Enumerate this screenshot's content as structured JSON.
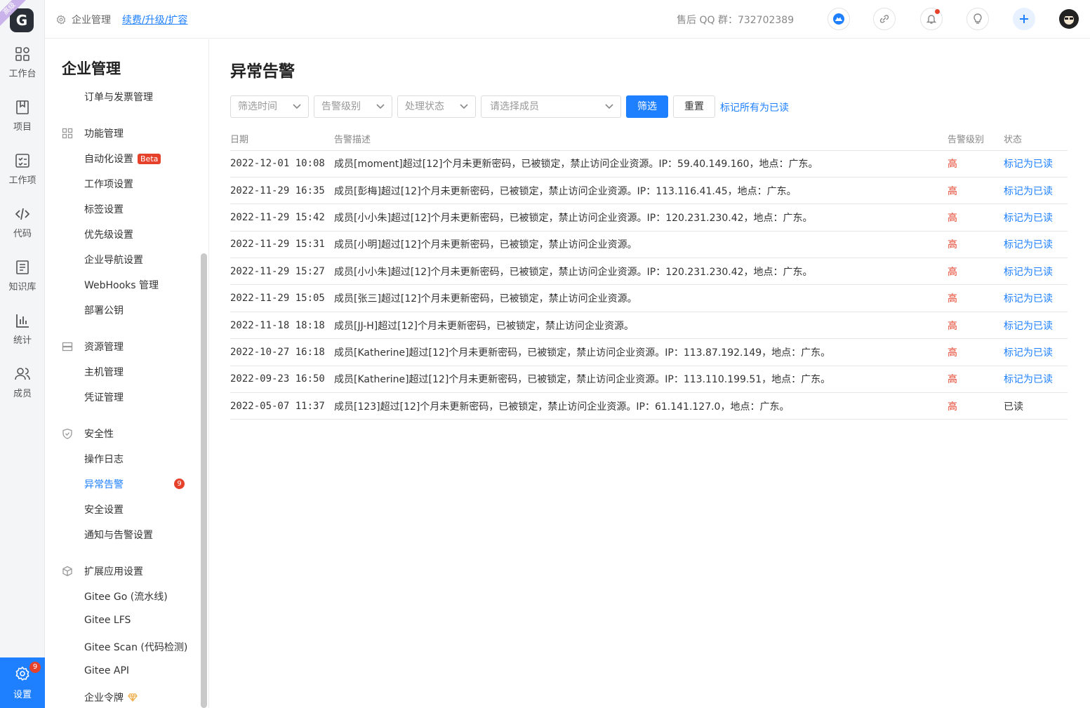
{
  "rail": {
    "logo": "G",
    "ribbon": "高级",
    "items": [
      {
        "label": "工作台"
      },
      {
        "label": "项目"
      },
      {
        "label": "工作项"
      },
      {
        "label": "代码"
      },
      {
        "label": "知识库"
      },
      {
        "label": "统计"
      },
      {
        "label": "成员"
      }
    ],
    "settings_label": "设置",
    "settings_badge": "9"
  },
  "topbar": {
    "crumb": "企业管理",
    "upgrade_link": "续费/升级/扩容",
    "qq": "售后 QQ 群：732702389"
  },
  "sidebar": {
    "title": "企业管理",
    "items": {
      "orders": "订单与发票管理",
      "func_group": "功能管理",
      "automation": "自动化设置",
      "beta": "Beta",
      "workitem": "工作项设置",
      "labels": "标签设置",
      "priority": "优先级设置",
      "navigation": "企业导航设置",
      "webhooks": "WebHooks 管理",
      "deploy_keys": "部署公钥",
      "resource_group": "资源管理",
      "hosts": "主机管理",
      "credentials": "凭证管理",
      "security_group": "安全性",
      "op_logs": "操作日志",
      "alerts": "异常告警",
      "alerts_badge": "9",
      "security_settings": "安全设置",
      "notify": "通知与告警设置",
      "ext_group": "扩展应用设置",
      "gitee_go": "Gitee Go (流水线)",
      "gitee_lfs": "Gitee LFS",
      "gitee_scan": "Gitee Scan (代码检测)",
      "gitee_api": "Gitee API",
      "token": "企业令牌"
    }
  },
  "main": {
    "title": "异常告警",
    "filters": {
      "time": "筛选时间",
      "level": "告警级别",
      "status": "处理状态",
      "member": "请选择成员"
    },
    "filter_btn": "筛选",
    "reset_btn": "重置",
    "mark_all": "标记所有为已读",
    "columns": {
      "date": "日期",
      "desc": "告警描述",
      "level": "告警级别",
      "status": "状态"
    },
    "rows": [
      {
        "date": "2022-12-01 10:08",
        "desc": "成员[moment]超过[12]个月未更新密码，已被锁定，禁止访问企业资源。IP：59.40.149.160，地点：广东。",
        "level": "高",
        "status": "标记为已读"
      },
      {
        "date": "2022-11-29 16:35",
        "desc": "成员[彭梅]超过[12]个月未更新密码，已被锁定，禁止访问企业资源。IP：113.116.41.45，地点：广东。",
        "level": "高",
        "status": "标记为已读"
      },
      {
        "date": "2022-11-29 15:42",
        "desc": "成员[小小朱]超过[12]个月未更新密码，已被锁定，禁止访问企业资源。IP：120.231.230.42，地点：广东。",
        "level": "高",
        "status": "标记为已读"
      },
      {
        "date": "2022-11-29 15:31",
        "desc": "成员[小明]超过[12]个月未更新密码，已被锁定，禁止访问企业资源。",
        "level": "高",
        "status": "标记为已读"
      },
      {
        "date": "2022-11-29 15:27",
        "desc": "成员[小小朱]超过[12]个月未更新密码，已被锁定，禁止访问企业资源。IP：120.231.230.42，地点：广东。",
        "level": "高",
        "status": "标记为已读"
      },
      {
        "date": "2022-11-29 15:05",
        "desc": "成员[张三]超过[12]个月未更新密码，已被锁定，禁止访问企业资源。",
        "level": "高",
        "status": "标记为已读"
      },
      {
        "date": "2022-11-18 18:18",
        "desc": "成员[JJ-H]超过[12]个月未更新密码，已被锁定，禁止访问企业资源。",
        "level": "高",
        "status": "标记为已读"
      },
      {
        "date": "2022-10-27 16:18",
        "desc": "成员[Katherine]超过[12]个月未更新密码，已被锁定，禁止访问企业资源。IP：113.87.192.149，地点：广东。",
        "level": "高",
        "status": "标记为已读"
      },
      {
        "date": "2022-09-23 16:50",
        "desc": "成员[Katherine]超过[12]个月未更新密码，已被锁定，禁止访问企业资源。IP：113.110.199.51，地点：广东。",
        "level": "高",
        "status": "标记为已读"
      },
      {
        "date": "2022-05-07 11:37",
        "desc": "成员[123]超过[12]个月未更新密码，已被锁定，禁止访问企业资源。IP：61.141.127.0，地点：广东。",
        "level": "高",
        "status": "已读"
      }
    ]
  },
  "colors": {
    "accent": "#1e80ff",
    "danger": "#e5412b"
  }
}
